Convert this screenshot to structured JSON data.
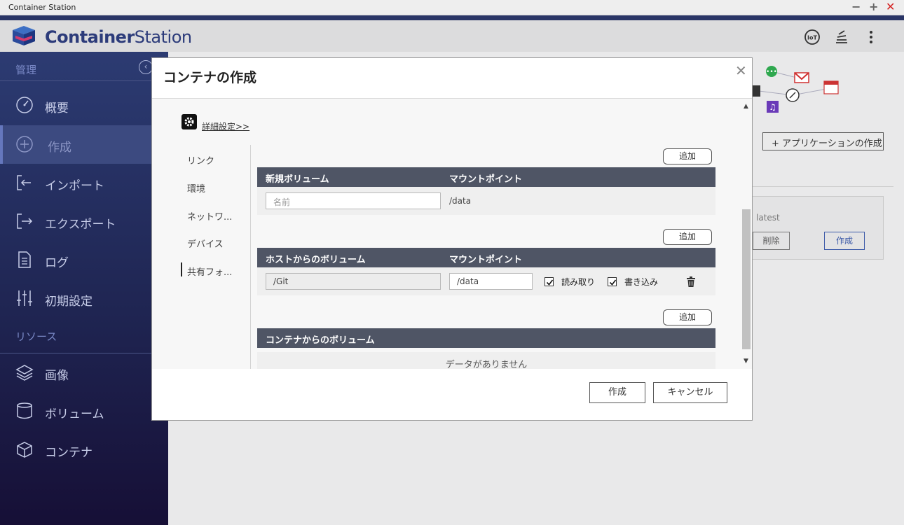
{
  "window": {
    "title": "Container Station"
  },
  "header": {
    "brand_bold": "Container",
    "brand_light": "Station"
  },
  "sidebar": {
    "section_manage": "管理",
    "section_resources": "リソース",
    "items": [
      {
        "label": "概要",
        "icon": "dashboard-icon"
      },
      {
        "label": "作成",
        "icon": "plus-circle-icon"
      },
      {
        "label": "インポート",
        "icon": "import-icon"
      },
      {
        "label": "エクスポート",
        "icon": "export-icon"
      },
      {
        "label": "ログ",
        "icon": "document-icon"
      },
      {
        "label": "初期設定",
        "icon": "sliders-icon"
      }
    ],
    "resource_items": [
      {
        "label": "画像",
        "icon": "layers-icon"
      },
      {
        "label": "ボリューム",
        "icon": "cylinder-icon"
      },
      {
        "label": "コンテナ",
        "icon": "cube-icon"
      }
    ]
  },
  "background": {
    "create_app_button": "+ アプリケーションの作成",
    "card_tag": "latest",
    "card_delete": "削除",
    "card_create": "作成"
  },
  "dialog": {
    "title": "コンテナの作成",
    "advanced_link": "詳細設定>>",
    "tabs": [
      "リンク",
      "環境",
      "ネットワ...",
      "デバイス",
      "共有フォ..."
    ],
    "active_tab": "共有フォ...",
    "add_label": "追加",
    "new_volume": {
      "col_name": "新規ボリューム",
      "col_mount": "マウントポイント",
      "name_placeholder": "名前",
      "mount_value": "/data"
    },
    "host_volume": {
      "col_name": "ホストからのボリューム",
      "col_mount": "マウントポイント",
      "host_path": "/Git",
      "mount_value": "/data",
      "read_label": "読み取り",
      "write_label": "書き込み",
      "read_checked": true,
      "write_checked": true
    },
    "container_volume": {
      "col_name": "コンテナからのボリューム",
      "empty_text": "データがありません"
    },
    "create_button": "作成",
    "cancel_button": "キャンセル"
  }
}
